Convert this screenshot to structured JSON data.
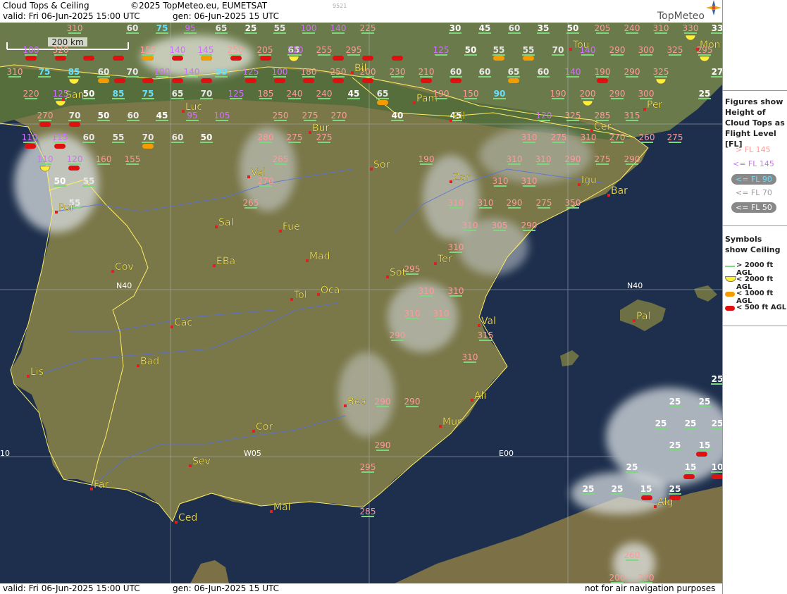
{
  "header": {
    "title": "Cloud Tops & Ceiling",
    "copyright": "©2025 TopMeteo.eu, EUMETSAT",
    "code": "9521",
    "valid": "valid:  Fri  06-Jun-2025  15:00 UTC",
    "gen": "gen: 06-Jun-2025 15 UTC",
    "logo": "TopMeteo"
  },
  "footer": {
    "valid": "valid:  Fri  06-Jun-2025  15:00 UTC",
    "gen": "gen: 06-Jun-2025 15 UTC",
    "note": "not for air navigation purposes"
  },
  "scale": "200 km",
  "grid_labels": {
    "n40_left": "N40",
    "n40_right": "N40",
    "w05": "W05",
    "e00": "E00",
    "w10": "10"
  },
  "cities": [
    {
      "name": "Tou"
    },
    {
      "name": "Mon"
    },
    {
      "name": "Bil"
    },
    {
      "name": "Pam"
    },
    {
      "name": "Cil"
    },
    {
      "name": "Per"
    },
    {
      "name": "Luc"
    },
    {
      "name": "Bur"
    },
    {
      "name": "Cer"
    },
    {
      "name": "Val"
    },
    {
      "name": "Sor"
    },
    {
      "name": "Zar"
    },
    {
      "name": "Igu"
    },
    {
      "name": "Bar"
    },
    {
      "name": "Por"
    },
    {
      "name": "Sal"
    },
    {
      "name": "Fue"
    },
    {
      "name": "Mad"
    },
    {
      "name": "EBa"
    },
    {
      "name": "Cov"
    },
    {
      "name": "Sot"
    },
    {
      "name": "Ter"
    },
    {
      "name": "Tol"
    },
    {
      "name": "Oca"
    },
    {
      "name": "Cac"
    },
    {
      "name": "Pal"
    },
    {
      "name": "Val"
    },
    {
      "name": "Lis"
    },
    {
      "name": "Bad"
    },
    {
      "name": "Bea"
    },
    {
      "name": "Ali"
    },
    {
      "name": "Cor"
    },
    {
      "name": "Mur"
    },
    {
      "name": "Sev"
    },
    {
      "name": "Far"
    },
    {
      "name": "Mal"
    },
    {
      "name": "Ced"
    },
    {
      "name": "Alg"
    },
    {
      "name": "San"
    }
  ],
  "tops": [
    {
      "v": "310"
    },
    {
      "v": "60"
    },
    {
      "v": "75"
    },
    {
      "v": "95"
    },
    {
      "v": "65"
    },
    {
      "v": "25"
    },
    {
      "v": "55"
    },
    {
      "v": "100"
    },
    {
      "v": "140"
    },
    {
      "v": "225"
    },
    {
      "v": "30"
    },
    {
      "v": "45"
    },
    {
      "v": "60"
    },
    {
      "v": "35"
    },
    {
      "v": "50"
    },
    {
      "v": "205"
    },
    {
      "v": "240"
    },
    {
      "v": "310"
    },
    {
      "v": "330"
    },
    {
      "v": "33"
    },
    {
      "v": "100"
    },
    {
      "v": "320"
    },
    {
      "v": "155"
    },
    {
      "v": "140"
    },
    {
      "v": "145"
    },
    {
      "v": "250"
    },
    {
      "v": "205"
    },
    {
      "v": "65"
    },
    {
      "v": "110"
    },
    {
      "v": "255"
    },
    {
      "v": "295"
    },
    {
      "v": "125"
    },
    {
      "v": "50"
    },
    {
      "v": "55"
    },
    {
      "v": "55"
    },
    {
      "v": "70"
    },
    {
      "v": "140"
    },
    {
      "v": "290"
    },
    {
      "v": "300"
    },
    {
      "v": "325"
    },
    {
      "v": "295"
    },
    {
      "v": "310"
    },
    {
      "v": "75"
    },
    {
      "v": "85"
    },
    {
      "v": "60"
    },
    {
      "v": "70"
    },
    {
      "v": "100"
    },
    {
      "v": "140"
    },
    {
      "v": "90"
    },
    {
      "v": "125"
    },
    {
      "v": "100"
    },
    {
      "v": "180"
    },
    {
      "v": "250"
    },
    {
      "v": "200"
    },
    {
      "v": "230"
    },
    {
      "v": "210"
    },
    {
      "v": "60"
    },
    {
      "v": "60"
    },
    {
      "v": "65"
    },
    {
      "v": "60"
    },
    {
      "v": "140"
    },
    {
      "v": "190"
    },
    {
      "v": "290"
    },
    {
      "v": "325"
    },
    {
      "v": "27"
    },
    {
      "v": "220"
    },
    {
      "v": "125"
    },
    {
      "v": "50"
    },
    {
      "v": "85"
    },
    {
      "v": "75"
    },
    {
      "v": "65"
    },
    {
      "v": "70"
    },
    {
      "v": "125"
    },
    {
      "v": "185"
    },
    {
      "v": "240"
    },
    {
      "v": "240"
    },
    {
      "v": "45"
    },
    {
      "v": "65"
    },
    {
      "v": "190"
    },
    {
      "v": "150"
    },
    {
      "v": "90"
    },
    {
      "v": "190"
    },
    {
      "v": "200"
    },
    {
      "v": "290"
    },
    {
      "v": "300"
    },
    {
      "v": "25"
    },
    {
      "v": "270"
    },
    {
      "v": "70"
    },
    {
      "v": "50"
    },
    {
      "v": "60"
    },
    {
      "v": "45"
    },
    {
      "v": "95"
    },
    {
      "v": "105"
    },
    {
      "v": "250"
    },
    {
      "v": "275"
    },
    {
      "v": "270"
    },
    {
      "v": "40"
    },
    {
      "v": "45"
    },
    {
      "v": "120"
    },
    {
      "v": "325"
    },
    {
      "v": "285"
    },
    {
      "v": "315"
    },
    {
      "v": "110"
    },
    {
      "v": "115"
    },
    {
      "v": "60"
    },
    {
      "v": "55"
    },
    {
      "v": "70"
    },
    {
      "v": "60"
    },
    {
      "v": "50"
    },
    {
      "v": "280"
    },
    {
      "v": "275"
    },
    {
      "v": "275"
    },
    {
      "v": "310"
    },
    {
      "v": "275"
    },
    {
      "v": "310"
    },
    {
      "v": "270"
    },
    {
      "v": "260"
    },
    {
      "v": "275"
    },
    {
      "v": "110"
    },
    {
      "v": "120"
    },
    {
      "v": "160"
    },
    {
      "v": "155"
    },
    {
      "v": "265"
    },
    {
      "v": "190"
    },
    {
      "v": "310"
    },
    {
      "v": "310"
    },
    {
      "v": "290"
    },
    {
      "v": "275"
    },
    {
      "v": "290"
    },
    {
      "v": "50"
    },
    {
      "v": "55"
    },
    {
      "v": "270"
    },
    {
      "v": "310"
    },
    {
      "v": "310"
    },
    {
      "v": "55"
    },
    {
      "v": "265"
    },
    {
      "v": "310"
    },
    {
      "v": "310"
    },
    {
      "v": "290"
    },
    {
      "v": "275"
    },
    {
      "v": "350"
    },
    {
      "v": "310"
    },
    {
      "v": "305"
    },
    {
      "v": "290"
    },
    {
      "v": "310"
    },
    {
      "v": "295"
    },
    {
      "v": "310"
    },
    {
      "v": "310"
    },
    {
      "v": "310"
    },
    {
      "v": "310"
    },
    {
      "v": "315"
    },
    {
      "v": "290"
    },
    {
      "v": "310"
    },
    {
      "v": "290"
    },
    {
      "v": "290"
    },
    {
      "v": "290"
    },
    {
      "v": "295"
    },
    {
      "v": "285"
    },
    {
      "v": "25"
    },
    {
      "v": "25"
    },
    {
      "v": "25"
    },
    {
      "v": "25"
    },
    {
      "v": "25"
    },
    {
      "v": "25"
    },
    {
      "v": "25"
    },
    {
      "v": "15"
    },
    {
      "v": "25"
    },
    {
      "v": "15"
    },
    {
      "v": "10"
    },
    {
      "v": "25"
    },
    {
      "v": "25"
    },
    {
      "v": "15"
    },
    {
      "v": "25"
    },
    {
      "v": "260"
    },
    {
      "v": "200"
    },
    {
      "v": "220"
    }
  ],
  "legend": {
    "figures_title": "Figures show Height of Cloud Tops as Flight Level  [FL]",
    "items": [
      {
        "label": "> FL 145",
        "color": "#ff9a9a"
      },
      {
        "label": "<= FL 145",
        "color": "#d070ff"
      },
      {
        "label": "<= FL 90",
        "color": "#66e0ff"
      },
      {
        "label": "<= FL 70",
        "color": "#dddddd"
      },
      {
        "label": "<= FL 50",
        "color": "#ffffff"
      }
    ],
    "symbols_title": "Symbols show Ceiling",
    "symbols": [
      {
        "label": "> 2000 ft AGL"
      },
      {
        "label": "< 2000 ft AGL"
      },
      {
        "label": "< 1000 ft AGL"
      },
      {
        "label": "< 500 ft AGL"
      }
    ]
  }
}
